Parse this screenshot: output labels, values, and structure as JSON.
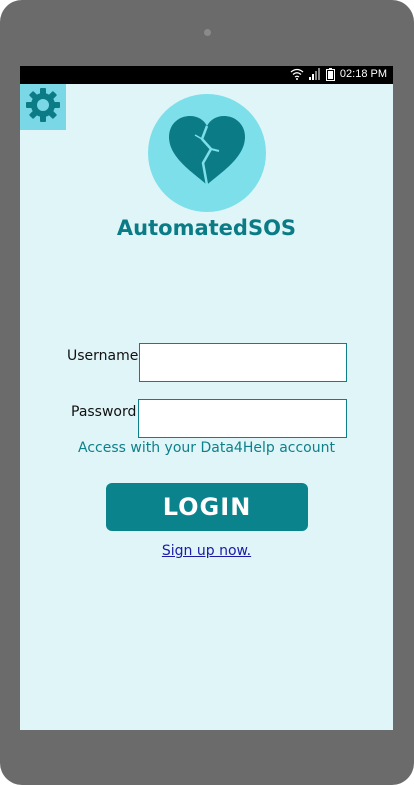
{
  "status_bar": {
    "time": "02:18 PM",
    "icons": [
      "wifi-icon",
      "signal-icon",
      "battery-icon"
    ]
  },
  "settings_icon": "gear-icon",
  "logo_icon": "broken-heart-icon",
  "app": {
    "title": "AutomatedSOS"
  },
  "form": {
    "username_label": "Username",
    "username_value": "",
    "password_label": "Password",
    "password_value": "",
    "hint": "Access with your Data4Help account"
  },
  "actions": {
    "login_label": "LOGIN",
    "signup_label": "Sign up now."
  },
  "colors": {
    "accent": "#0b838d",
    "screen_bg": "#e0f5f8",
    "logo_bg": "#7ddfea",
    "link": "#1a1aa6"
  }
}
